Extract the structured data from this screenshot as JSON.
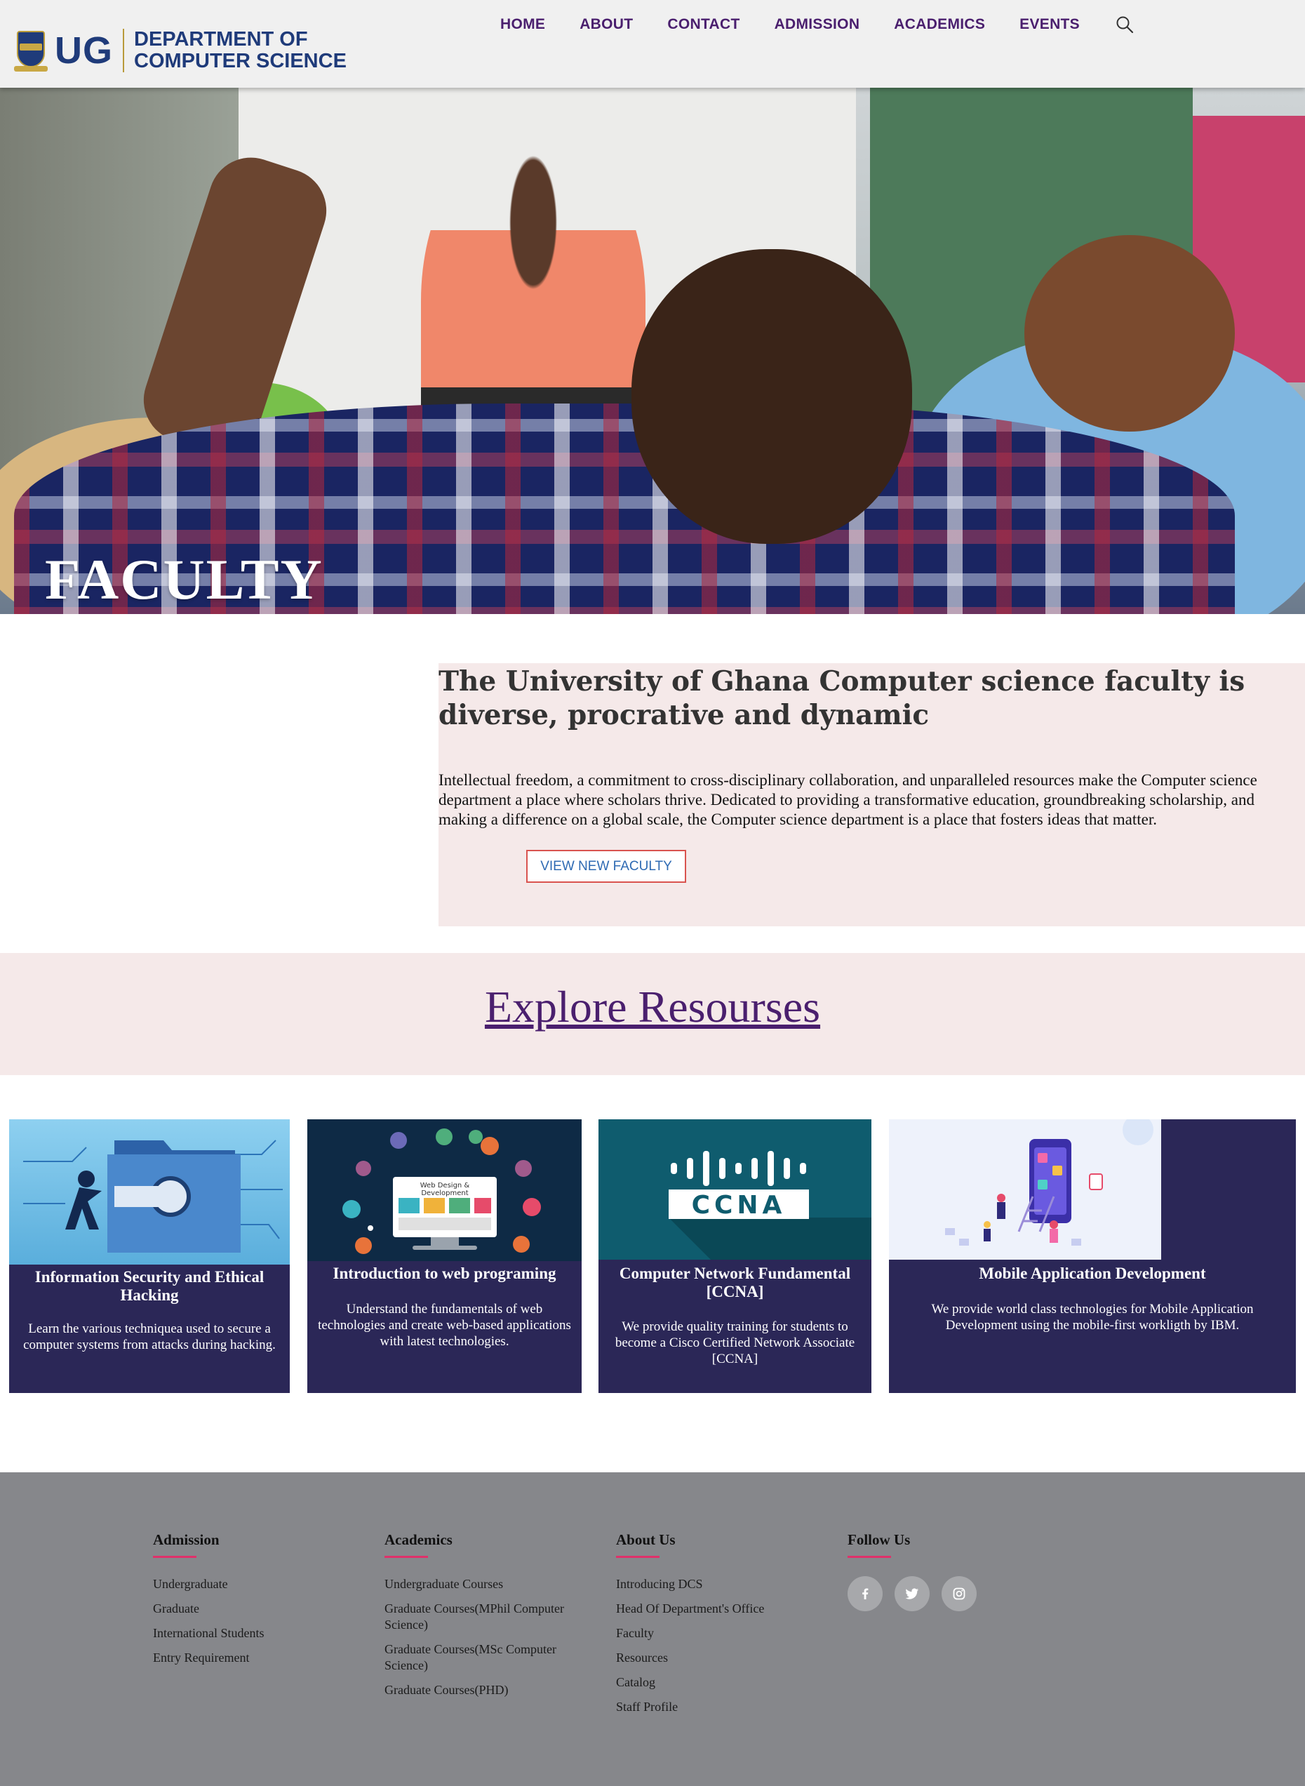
{
  "header": {
    "logo_mark": "UG",
    "logo_text_line1": "DEPARTMENT OF",
    "logo_text_line2": "COMPUTER SCIENCE",
    "nav": [
      "HOME",
      "ABOUT",
      "CONTACT",
      "ADMISSION",
      "ACADEMICS",
      "EVENTS"
    ],
    "search_icon": "search-icon"
  },
  "hero": {
    "title": "FACULTY"
  },
  "intro": {
    "title": "The University of Ghana Computer science faculty is diverse, procrative and dynamic",
    "body": "Intellectual freedom, a commitment to cross-disciplinary collaboration, and unparalleled resources make the Computer science department a place where scholars thrive. Dedicated to providing a transformative education, groundbreaking scholarship, and making a difference on a global scale, the Computer science department is a place that fosters ideas that matter.",
    "button": "VIEW NEW FACULTY"
  },
  "explore": {
    "title": "Explore Resourses"
  },
  "cards": [
    {
      "title": "Information Security and Ethical Hacking",
      "description": "Learn the various techniquea used to secure a computer systems from attacks during hacking."
    },
    {
      "title": "Introduction to web programing",
      "description": "Understand the fundamentals of web technologies and create web-based applications with latest technologies.",
      "image_caption_line1": "Web Design &",
      "image_caption_line2": "Development"
    },
    {
      "title": "Computer Network Fundamental [CCNA]",
      "description": "We provide quality training for students to become a Cisco Certified Network Associate [CCNA]",
      "image_logo_text": "CCNA"
    },
    {
      "title": "Mobile Application Development",
      "description": "We provide world class technologies for Mobile Application Development using the mobile-first workligth by IBM."
    }
  ],
  "footer": {
    "columns": [
      {
        "heading": "Admission",
        "links": [
          "Undergraduate",
          "Graduate",
          "International Students",
          "Entry Requirement"
        ]
      },
      {
        "heading": "Academics",
        "links": [
          "Undergraduate Courses",
          "Graduate Courses(MPhil Computer Science)",
          "Graduate Courses(MSc Computer Science)",
          "Graduate Courses(PHD)"
        ]
      },
      {
        "heading": "About Us",
        "links": [
          "Introducing DCS",
          "Head Of Department's Office",
          "Faculty",
          "Resources",
          "Catalog",
          "Staff Profile"
        ]
      },
      {
        "heading": "Follow Us",
        "social": [
          "facebook-icon",
          "twitter-icon",
          "instagram-icon"
        ]
      }
    ],
    "accent_color": "#e0306a"
  },
  "colors": {
    "nav_text": "#4a1f6e",
    "logo_blue": "#1f3b7a",
    "card_bg": "#2b2757",
    "section_tint": "#f5e9e9",
    "footer_bg": "#86878b"
  }
}
